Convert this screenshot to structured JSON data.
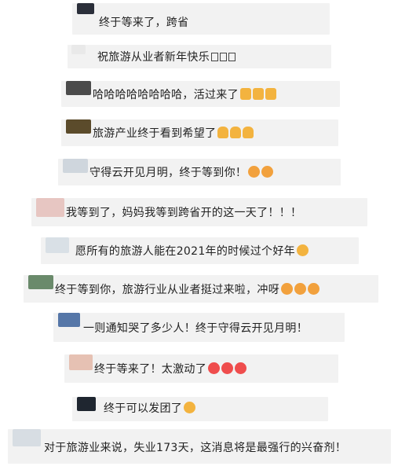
{
  "colors": {
    "bubble": "#f2f2f2",
    "text": "#222222",
    "name": "#9aa0a6",
    "emoji_yellow": "#f3b33f",
    "emoji_red": "#ef4d4d",
    "emoji_orange": "#f2a13d"
  },
  "comments": [
    {
      "id": "c1",
      "name": "",
      "text": "终于等来了，跨省",
      "emoji": []
    },
    {
      "id": "c2",
      "name": "",
      "text": "祝旅游从业者新年快乐",
      "emoji": [
        "unknown-char-box",
        "unknown-char-box",
        "unknown-char-box"
      ]
    },
    {
      "id": "c3",
      "name": "",
      "text": "哈哈哈哈哈哈哈哈，活过来了",
      "emoji": [
        "victory-hand-emoji",
        "victory-hand-emoji",
        "victory-hand-emoji"
      ]
    },
    {
      "id": "c4",
      "name": "",
      "text": "旅游产业终于看到希望了",
      "emoji": [
        "thumbs-up-emoji",
        "thumbs-up-emoji",
        "thumbs-up-emoji"
      ]
    },
    {
      "id": "c5",
      "name": "",
      "text": "守得云开见月明，终于等到你！",
      "emoji": [
        "flushed-face-emoji",
        "flushed-face-emoji"
      ]
    },
    {
      "id": "c6",
      "name": "",
      "text": "我等到了，妈妈我等到跨省开的这一天了！！！",
      "emoji": []
    },
    {
      "id": "c7",
      "name": "",
      "text": "愿所有的旅游人能在2021年的时候过个好年",
      "emoji": [
        "fist-emoji"
      ]
    },
    {
      "id": "c8",
      "name": "",
      "text": "终于等到你，旅游行业从业者挺过来啦，冲呀",
      "emoji": [
        "flushed-face-emoji",
        "flushed-face-emoji",
        "flushed-face-emoji"
      ]
    },
    {
      "id": "c9",
      "name": "",
      "text": "一则通知哭了多少人！终于守得云开见月明！",
      "emoji": []
    },
    {
      "id": "c10",
      "name": "",
      "text": "终于等来了！太激动了",
      "emoji": [
        "surprised-face-emoji",
        "surprised-face-emoji",
        "surprised-face-emoji"
      ]
    },
    {
      "id": "c11",
      "name": "",
      "text": "终于可以发团了",
      "emoji": [
        "sunglasses-face-emoji"
      ]
    },
    {
      "id": "c12",
      "name": "",
      "text": "对于旅游业来说，失业173天，这消息将是最强行的兴奋剂！",
      "emoji": []
    }
  ]
}
